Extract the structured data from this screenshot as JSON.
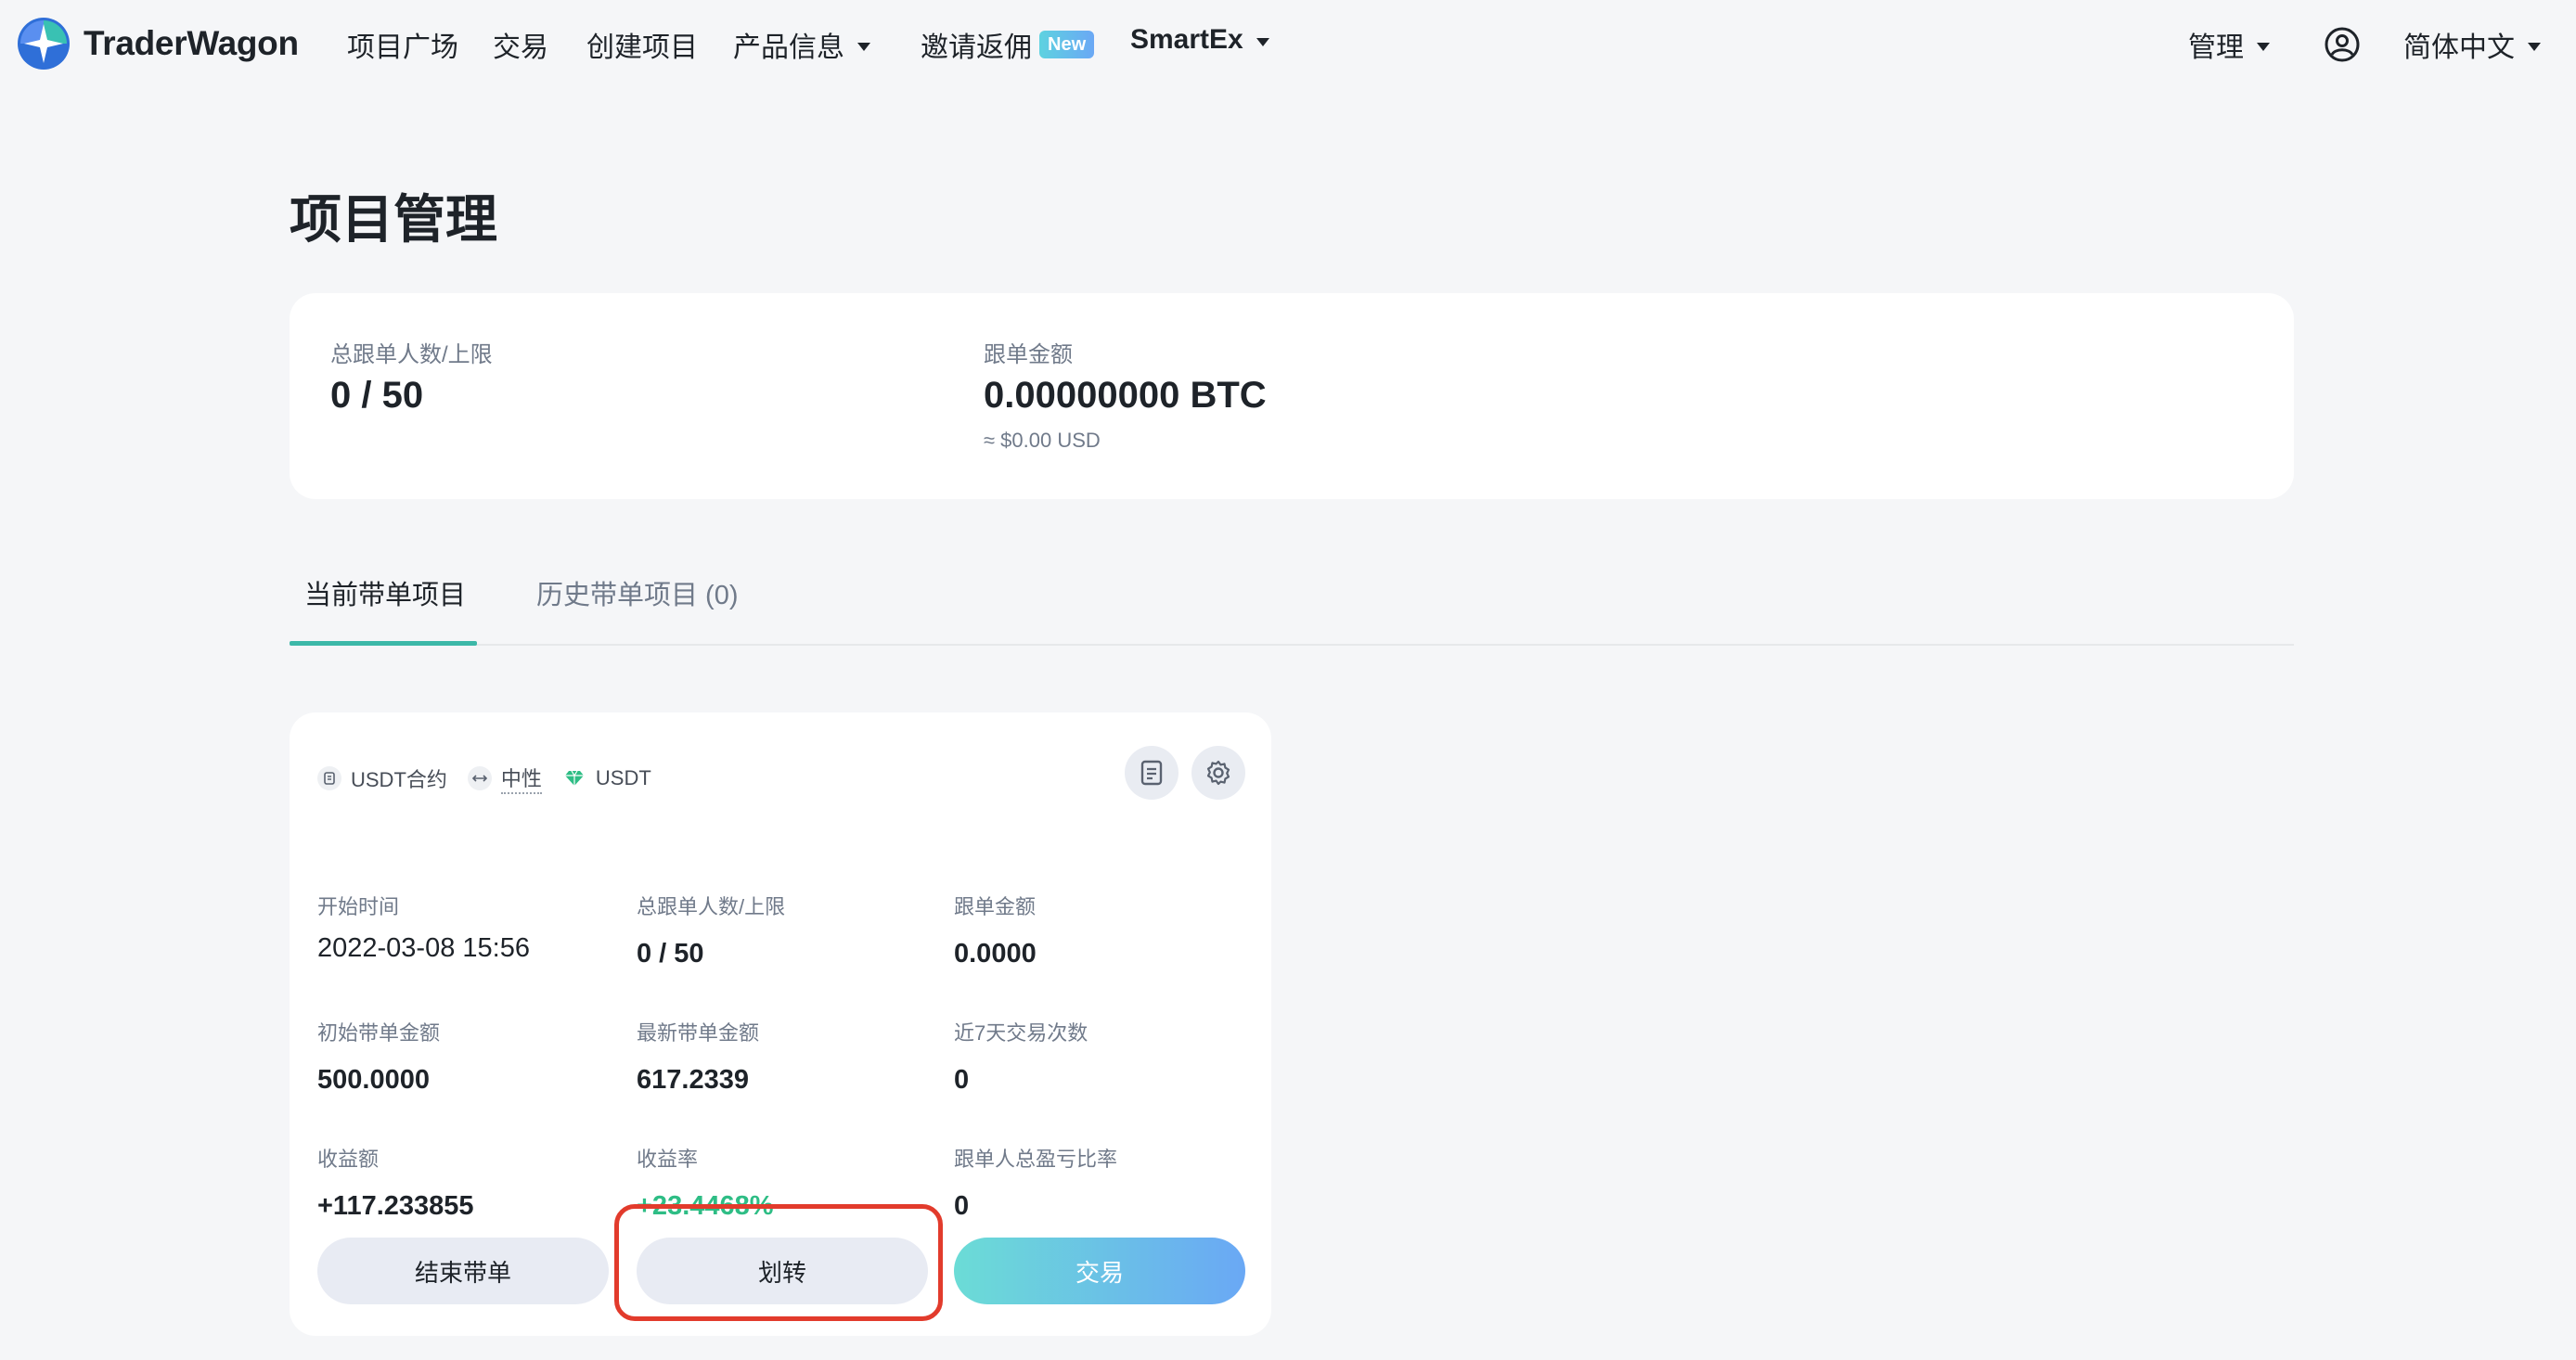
{
  "nav": {
    "brand": "TraderWagon",
    "items": [
      {
        "label": "项目广场"
      },
      {
        "label": "交易"
      },
      {
        "label": "创建项目"
      },
      {
        "label": "产品信息"
      },
      {
        "label": "邀请返佣",
        "badge": "New"
      },
      {
        "label": "SmartEx"
      }
    ],
    "manage": "管理",
    "language": "简体中文"
  },
  "page": {
    "title": "项目管理"
  },
  "summary": {
    "followers_label": "总跟单人数/上限",
    "followers_value": "0 / 50",
    "amount_label": "跟单金额",
    "amount_value": "0.00000000 BTC",
    "amount_usd": "≈ $0.00 USD"
  },
  "tabs": {
    "current": "当前带单项目",
    "history": "历史带单项目 (0)"
  },
  "project": {
    "tags": [
      "USDT合约",
      "中性",
      "USDT"
    ],
    "stats": {
      "start_time_label": "开始时间",
      "start_time": "2022-03-08 15:56",
      "followers_label": "总跟单人数/上限",
      "followers": "0 / 50",
      "follow_amount_label": "跟单金额",
      "follow_amount": "0.0000",
      "initial_amount_label": "初始带单金额",
      "initial_amount": "500.0000",
      "latest_amount_label": "最新带单金额",
      "latest_amount": "617.2339",
      "trades_7d_label": "近7天交易次数",
      "trades_7d": "0",
      "profit_label": "收益额",
      "profit": "+117.233855",
      "roi_label": "收益率",
      "roi": "+23.4468%",
      "follower_pnl_label": "跟单人总盈亏比率",
      "follower_pnl": "0"
    },
    "buttons": {
      "end": "结束带单",
      "transfer": "划转",
      "trade": "交易"
    }
  },
  "colors": {
    "accent": "#3cb8a8",
    "profit_green": "#2ebd85",
    "highlight_red": "#e23b2c"
  }
}
